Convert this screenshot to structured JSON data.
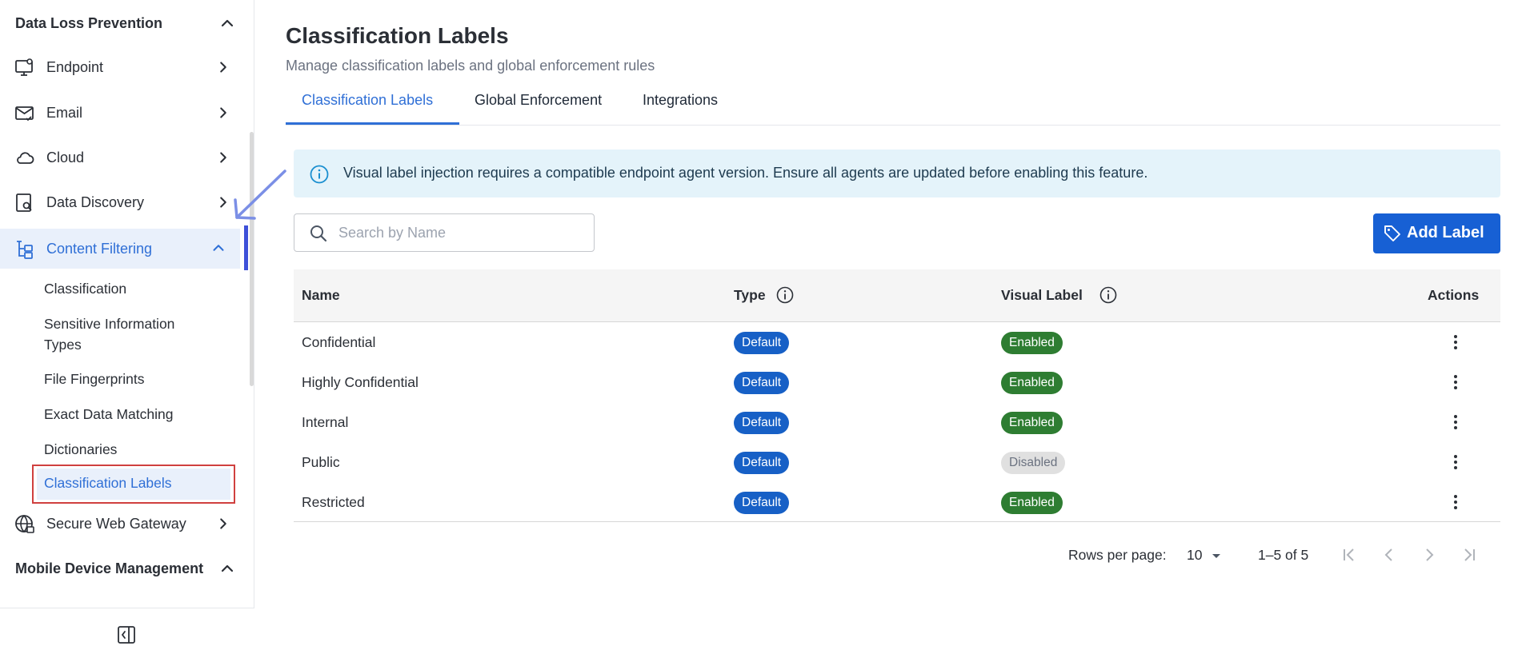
{
  "sidebar": {
    "dlp_section": "Data Loss Prevention",
    "items": [
      {
        "label": "Endpoint",
        "icon": "monitor-icon"
      },
      {
        "label": "Email",
        "icon": "mail-check-icon"
      },
      {
        "label": "Cloud",
        "icon": "cloud-icon"
      },
      {
        "label": "Data Discovery",
        "icon": "device-search-icon"
      },
      {
        "label": "Content Filtering",
        "icon": "tree-structure-icon"
      },
      {
        "label": "Secure Web Gateway",
        "icon": "globe-lock-icon"
      }
    ],
    "content_filtering_children": [
      "Classification",
      "Sensitive Information Types",
      "File Fingerprints",
      "Exact Data Matching",
      "Dictionaries",
      "Classification Labels"
    ],
    "sensitive_info_line1": "Sensitive Information",
    "sensitive_info_line2": "Types",
    "mdm_section": "Mobile Device Management"
  },
  "main": {
    "title": "Classification Labels",
    "subtitle": "Manage classification labels and global enforcement rules",
    "tabs": [
      {
        "label": "Classification Labels",
        "active": true
      },
      {
        "label": "Global Enforcement",
        "active": false
      },
      {
        "label": "Integrations",
        "active": false
      }
    ],
    "banner": "Visual label injection requires a compatible endpoint agent version. Ensure all agents are updated before enabling this feature.",
    "search_placeholder": "Search by Name",
    "add_button": "Add Label",
    "table": {
      "columns": [
        "Name",
        "Type",
        "Visual Label",
        "Actions"
      ],
      "rows": [
        {
          "name": "Confidential",
          "type": "Default",
          "visual": "Enabled"
        },
        {
          "name": "Highly Confidential",
          "type": "Default",
          "visual": "Enabled"
        },
        {
          "name": "Internal",
          "type": "Default",
          "visual": "Enabled"
        },
        {
          "name": "Public",
          "type": "Default",
          "visual": "Disabled"
        },
        {
          "name": "Restricted",
          "type": "Default",
          "visual": "Enabled"
        }
      ]
    },
    "pagination": {
      "rows_per_page_label": "Rows per page:",
      "rows_per_page_value": "10",
      "range": "1–5 of 5"
    }
  },
  "colors": {
    "accent": "#2f6fd6",
    "primary_button": "#1760d4",
    "enabled": "#2e7d32",
    "disabled_bg": "#e0e0e0",
    "banner_bg": "#e4f3fa",
    "highlight_box": "#d0403f"
  }
}
